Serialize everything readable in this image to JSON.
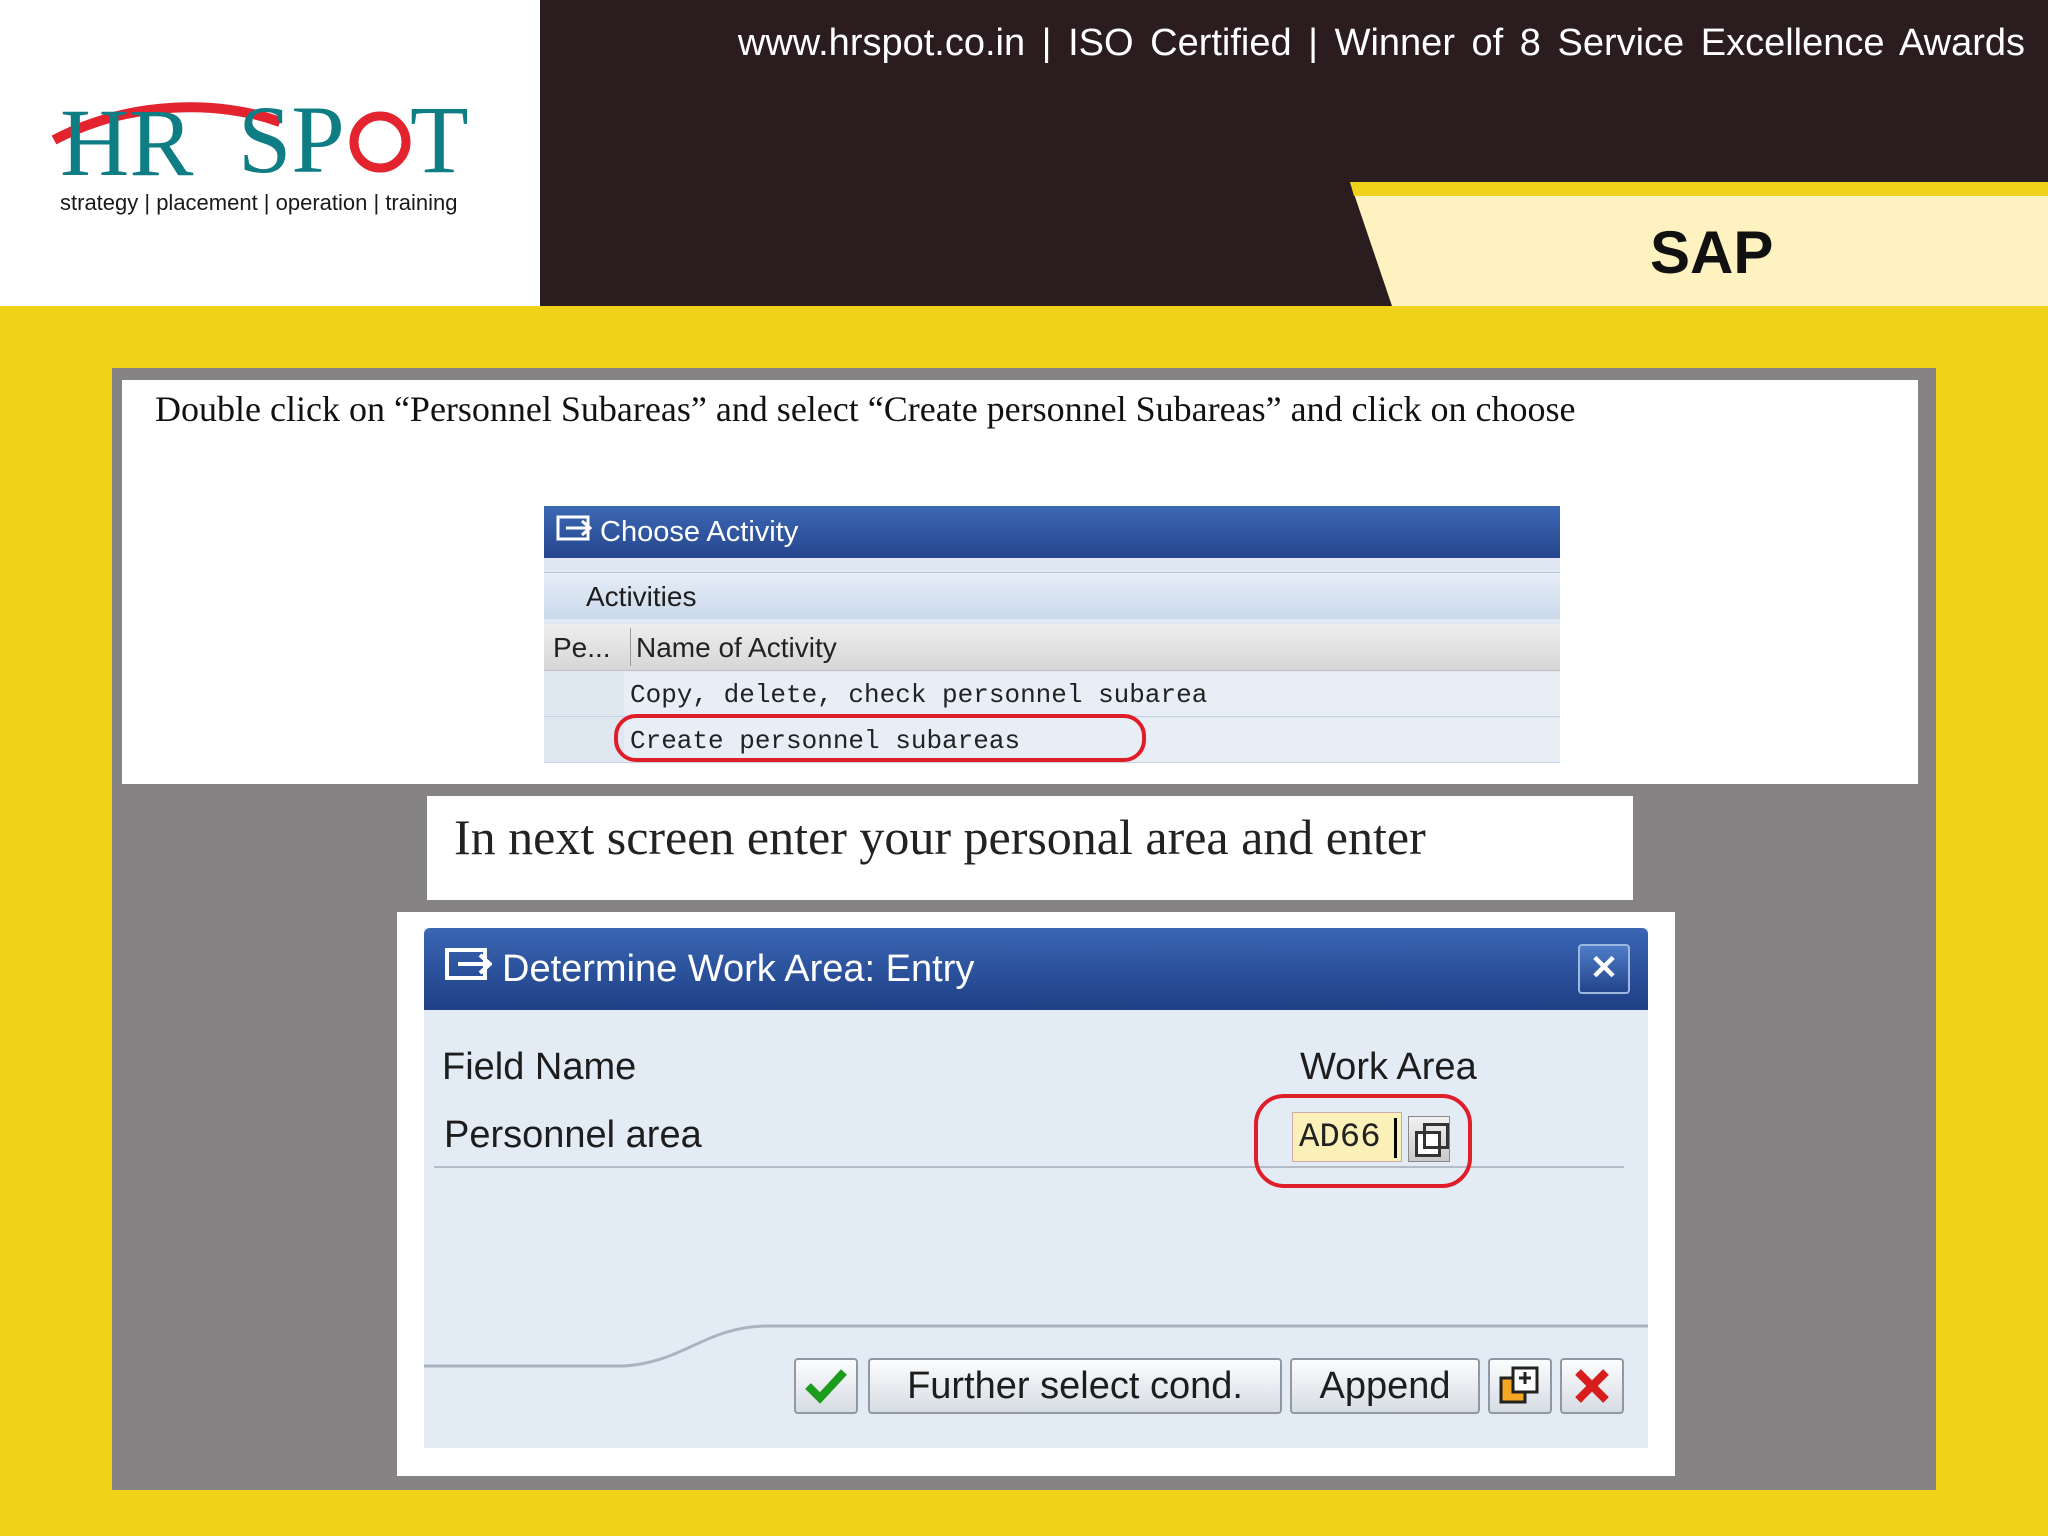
{
  "header": {
    "logo_text": "HR SPOT",
    "logo_tagline": "strategy | placement | operation | training",
    "top_line": "www.hrspot.co.in | ISO Certified | Winner of 8 Service Excellence Awards",
    "section_label": "SAP"
  },
  "instructions": {
    "step1": "Double click on “Personnel Subareas” and select “Create personnel Subareas” and click on choose",
    "step2": "In next screen enter your personal area and enter"
  },
  "choose_activity": {
    "title": "Choose Activity",
    "section": "Activities",
    "columns": [
      "Pe...",
      "Name of Activity"
    ],
    "rows": [
      "Copy, delete, check personnel subarea",
      "Create personnel subareas"
    ]
  },
  "work_area_dialog": {
    "title": "Determine Work Area: Entry",
    "field_name_header": "Field Name",
    "work_area_header": "Work Area",
    "field_label": "Personnel area",
    "field_value": "AD66",
    "buttons": {
      "further": "Further select cond.",
      "append": "Append"
    }
  },
  "colors": {
    "header_bg": "#2b1d1f",
    "accent_yellow": "#f1d21a",
    "sap_title_blue": "#25468e",
    "highlight_red": "#e01e2a"
  }
}
